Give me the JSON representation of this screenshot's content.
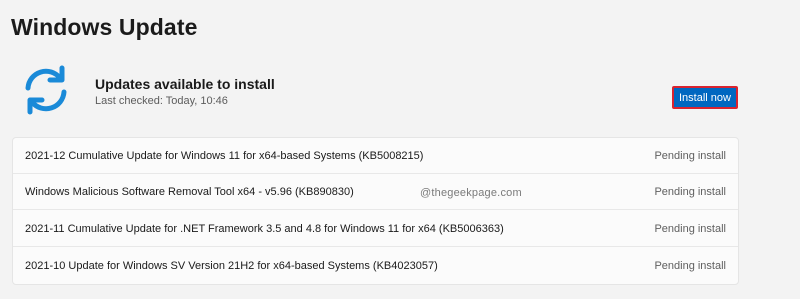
{
  "page": {
    "title": "Windows Update"
  },
  "status": {
    "icon": "sync-icon",
    "title": "Updates available to install",
    "last_checked": "Last checked: Today, 10:46",
    "install_button_label": "Install now"
  },
  "updates": [
    {
      "name": "2021-12 Cumulative Update for Windows 11 for x64-based Systems (KB5008215)",
      "status": "Pending install"
    },
    {
      "name": "Windows Malicious Software Removal Tool x64 - v5.96 (KB890830)",
      "status": "Pending install"
    },
    {
      "name": "2021-11 Cumulative Update for .NET Framework 3.5 and 4.8 for Windows 11 for x64 (KB5006363)",
      "status": "Pending install"
    },
    {
      "name": "2021-10 Update for Windows SV Version 21H2 for x64-based Systems (KB4023057)",
      "status": "Pending install"
    }
  ],
  "watermark": "@thegeekpage.com",
  "colors": {
    "accent": "#0067c0",
    "highlight_border": "#d9232f",
    "icon_blue": "#1a8ad8"
  }
}
